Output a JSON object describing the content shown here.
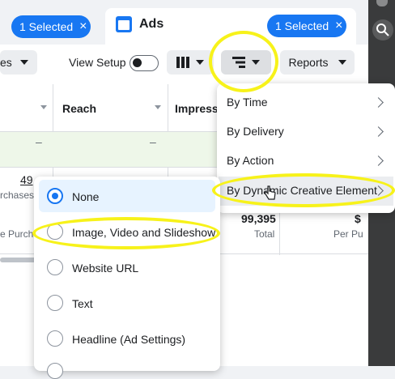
{
  "top": {
    "left_selected": "1 Selected",
    "right_tab_title": "Ads",
    "right_selected": "1 Selected",
    "close_symbol": "×"
  },
  "toolbar": {
    "left_cut_label": "es",
    "view_setup_label": "View Setup",
    "reports_label": "Reports"
  },
  "table": {
    "headers": [
      "Reach",
      "Impressi"
    ],
    "row_values": {
      "dash": "–",
      "left_number": "49",
      "left_sub": "rchases",
      "left_sub2": "e Purch",
      "impressions_value": "99,395",
      "impressions_sub": "Total",
      "right_value": "$",
      "right_sub": "Per Pu"
    }
  },
  "breakdown_menu": {
    "items": [
      {
        "label": "By Time"
      },
      {
        "label": "By Delivery"
      },
      {
        "label": "By Action"
      },
      {
        "label": "By Dynamic Creative Element"
      }
    ]
  },
  "dce_menu": {
    "options": [
      {
        "label": "None",
        "selected": true
      },
      {
        "label": "Image, Video and Slideshow",
        "selected": false
      },
      {
        "label": "Website URL",
        "selected": false
      },
      {
        "label": "Text",
        "selected": false
      },
      {
        "label": "Headline (Ad Settings)",
        "selected": false
      }
    ]
  },
  "colors": {
    "accent": "#1877f2",
    "highlight": "#f7f21a",
    "green_row": "#eef7e9"
  }
}
